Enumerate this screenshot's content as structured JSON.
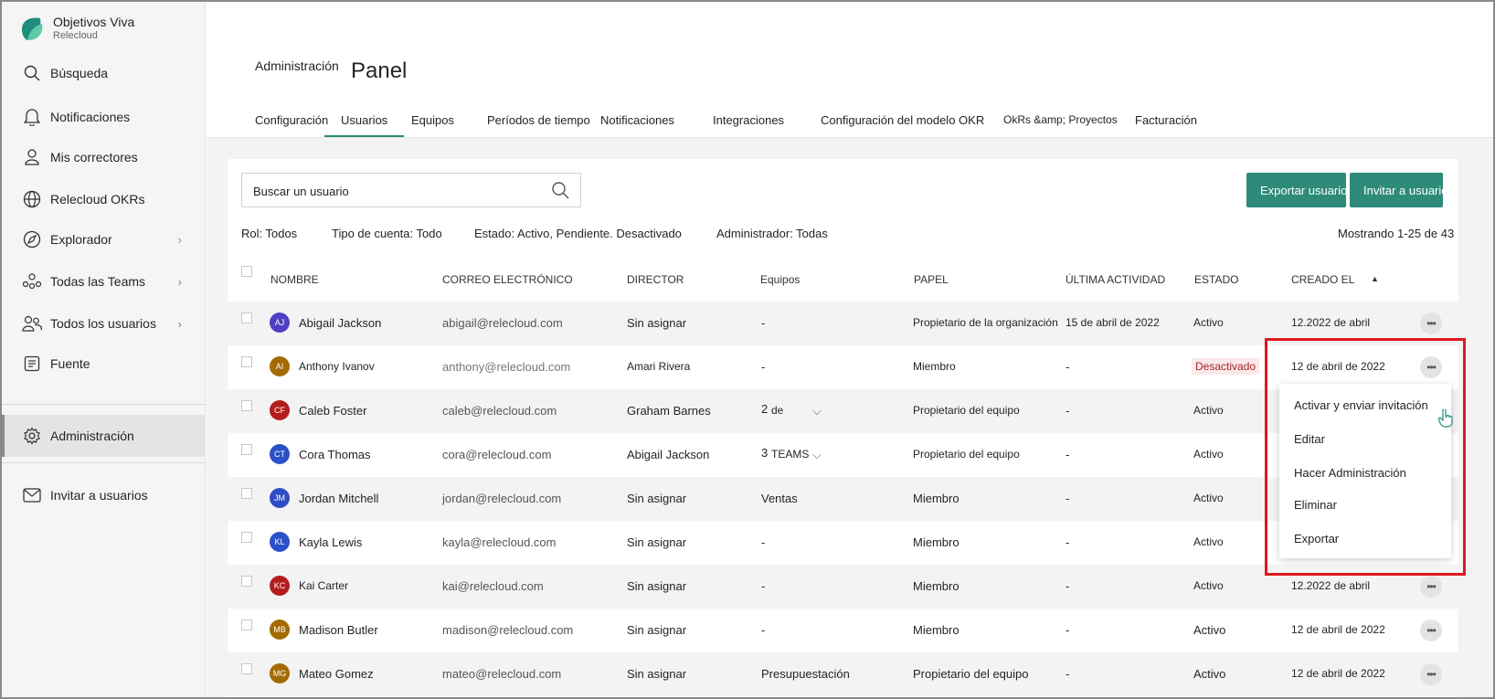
{
  "brand": {
    "title": "Objetivos Viva",
    "subtitle": "Relecloud"
  },
  "sidebar": {
    "items": [
      {
        "label": "Búsqueda",
        "icon": "search-icon"
      },
      {
        "label": "Notificaciones",
        "icon": "bell-icon"
      },
      {
        "label": "Mis correctores",
        "icon": "person-icon"
      },
      {
        "label": "Relecloud OKRs",
        "icon": "globe-icon"
      },
      {
        "label": "Explorador",
        "icon": "compass-icon"
      },
      {
        "label": "Todas las Teams",
        "icon": "teams-icon"
      },
      {
        "label": "Todos los usuarios",
        "icon": "people-icon"
      },
      {
        "label": "Fuente",
        "icon": "feed-icon"
      },
      {
        "label": "Administración",
        "icon": "gear-icon"
      },
      {
        "label": "Invitar a usuarios",
        "icon": "mail-icon"
      }
    ]
  },
  "header": {
    "section": "Administración",
    "title": "Panel"
  },
  "tabs": [
    "Configuración",
    "Usuarios",
    "Equipos",
    "Períodos de tiempo",
    "Notificaciones",
    "Integraciones",
    "Configuración del modelo OKR",
    "OkRs &amp; Proyectos",
    "Facturación"
  ],
  "search": {
    "placeholder": "Buscar un usuario"
  },
  "buttons": {
    "export": "Exportar usuarios",
    "invite": "Invitar a usuarios"
  },
  "filters": {
    "role": "Rol: Todos",
    "account": "Tipo de cuenta: Todo",
    "state": "Estado: Activo, Pendiente. Desactivado",
    "admin": "Administrador: Todas"
  },
  "showing": "Mostrando 1-25 de 43",
  "columns": [
    "NOMBRE",
    "CORREO ELECTRÓNICO",
    "DIRECTOR",
    "Equipos",
    "PAPEL",
    "ÚLTIMA ACTIVIDAD",
    "ESTADO",
    "CREADO EL"
  ],
  "rows": [
    {
      "initials": "AJ",
      "color": "#4f3fc2",
      "name": "Abigail Jackson",
      "email": "abigail@relecloud.com",
      "director": "Sin asignar",
      "teams": "-",
      "role": "Propietario de la organización",
      "last": "15 de abril de 2022",
      "state": "Activo",
      "created": "12.2022 de abril"
    },
    {
      "initials": "AI",
      "color": "#a36a00",
      "name": "Anthony Ivanov",
      "email": "anthony@relecloud.com",
      "director": "Amari Rivera",
      "teams": "-",
      "role": "Miembro",
      "last": "-",
      "state": "Desactivado",
      "created": "12 de abril de 2022"
    },
    {
      "initials": "CF",
      "color": "#b31d1d",
      "name": "Caleb Foster",
      "email": "caleb@relecloud.com",
      "director": "Graham Barnes",
      "teams_count": "2",
      "teams": "de",
      "role": "Propietario del equipo",
      "last": "-",
      "state": "Activo",
      "created": ""
    },
    {
      "initials": "CT",
      "color": "#2b51c9",
      "name": "Cora Thomas",
      "email": "cora@relecloud.com",
      "director": "Abigail Jackson",
      "teams_count": "3",
      "teams": "TEAMS",
      "role": "Propietario del equipo",
      "last": "-",
      "state": "Activo",
      "created": ""
    },
    {
      "initials": "JM",
      "color": "#2f4dc4",
      "name": "Jordan Mitchell",
      "email": "jordan@relecloud.com",
      "director": "Sin asignar",
      "teams": "Ventas",
      "role": "Miembro",
      "last": "-",
      "state": "Activo",
      "created": ""
    },
    {
      "initials": "KL",
      "color": "#2b51c9",
      "name": "Kayla Lewis",
      "email": "kayla@relecloud.com",
      "director": "Sin asignar",
      "teams": "-",
      "role": "Miembro",
      "last": "-",
      "state": "Activo",
      "created": ""
    },
    {
      "initials": "KC",
      "color": "#b31d1d",
      "name": "Kai Carter",
      "email": "kai@relecloud.com",
      "director": "Sin asignar",
      "teams": "-",
      "role": "Miembro",
      "last": "-",
      "state": "Activo",
      "created": "12.2022 de abril"
    },
    {
      "initials": "MB",
      "color": "#a36a00",
      "name": "Madison Butler",
      "email": "madison@relecloud.com",
      "director": "Sin asignar",
      "teams": "-",
      "role": "Miembro",
      "last": "-",
      "state": "Activo",
      "created": "12 de abril de 2022"
    },
    {
      "initials": "MG",
      "color": "#a36a00",
      "name": "Mateo Gomez",
      "email": "mateo@relecloud.com",
      "director": "Sin asignar",
      "teams": "Presupuestación",
      "role": "Propietario del equipo",
      "last": "-",
      "state": "Activo",
      "created": "12 de abril de 2022"
    }
  ],
  "context_menu": [
    "Activar y enviar invitación",
    "Editar",
    "Hacer Administración",
    "Eliminar",
    "Exportar"
  ]
}
